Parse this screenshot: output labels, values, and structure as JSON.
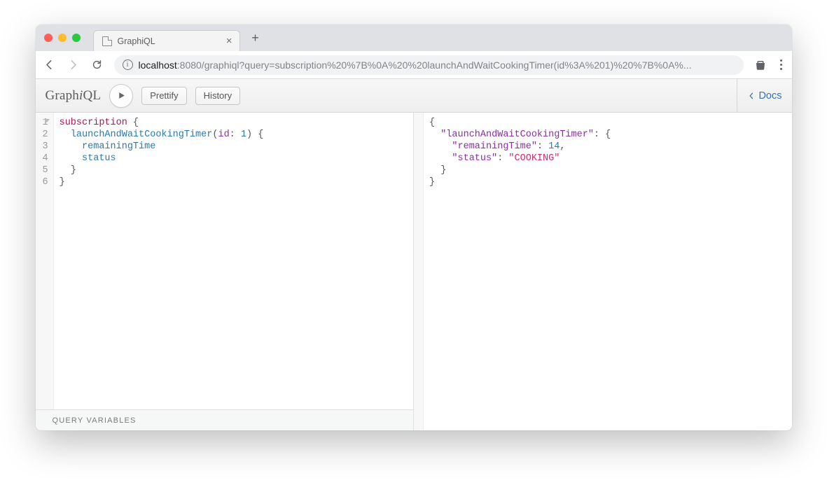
{
  "browser": {
    "tab_title": "GraphiQL",
    "url_host": "localhost",
    "url_port_path": ":8080/graphiql?query=subscription%20%7B%0A%20%20launchAndWaitCookingTimer(id%3A%201)%20%7B%0A%...",
    "new_tab_label": "+",
    "close_tab_label": "×"
  },
  "app": {
    "logo_plain1": "Graph",
    "logo_italic": "i",
    "logo_plain2": "QL",
    "prettify": "Prettify",
    "history": "History",
    "docs": "Docs",
    "query_variables": "Query Variables"
  },
  "editor": {
    "line_numbers": [
      "1",
      "2",
      "3",
      "4",
      "5",
      "6"
    ],
    "l1_kw": "subscription",
    "l1_brace": " {",
    "l2_indent": "  ",
    "l2_field": "launchAndWaitCookingTimer",
    "l2_paren_open": "(",
    "l2_arg": "id",
    "l2_colon": ": ",
    "l2_num": "1",
    "l2_paren_close": ")",
    "l2_brace": " {",
    "l3_indent": "    ",
    "l3_field": "remainingTime",
    "l4_indent": "    ",
    "l4_field": "status",
    "l5": "  }",
    "l6": "}"
  },
  "result": {
    "l1": "{",
    "l2_indent": "  ",
    "l2_key": "\"launchAndWaitCookingTimer\"",
    "l2_after": ": {",
    "l3_indent": "    ",
    "l3_key": "\"remainingTime\"",
    "l3_colon": ": ",
    "l3_val": "14",
    "l3_comma": ",",
    "l4_indent": "    ",
    "l4_key": "\"status\"",
    "l4_colon": ": ",
    "l4_val": "\"COOKING\"",
    "l5": "  }",
    "l6": "}"
  }
}
